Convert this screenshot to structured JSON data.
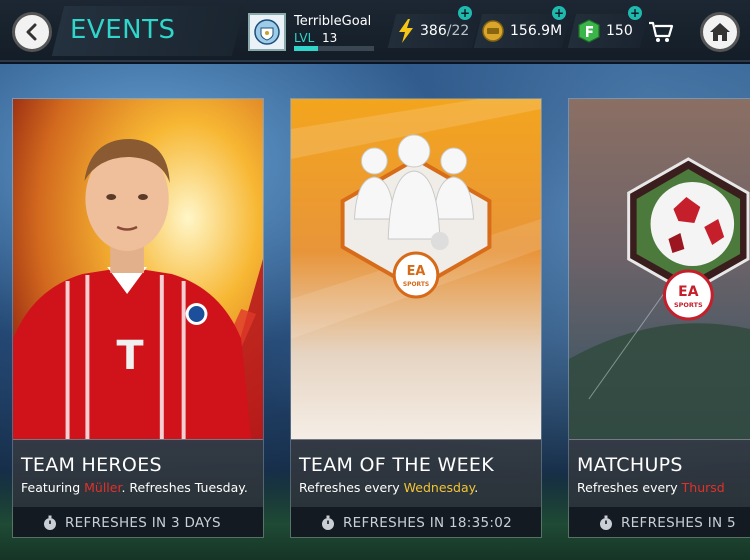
{
  "header": {
    "title": "EVENTS",
    "back_icon": "chevron-left-icon",
    "home_icon": "home-icon"
  },
  "profile": {
    "username": "TerribleGoal",
    "level_label": "LVL",
    "level": "13",
    "xp_progress": 0.3,
    "badge_icon": "club-crest-icon"
  },
  "currencies": {
    "stamina": {
      "value": "386",
      "max": "/22",
      "icon": "lightning-icon",
      "plus": "+"
    },
    "coins": {
      "value": "156.9M",
      "icon": "coin-icon",
      "plus": "+"
    },
    "points": {
      "value": "150",
      "icon": "fifa-points-icon",
      "plus": "+"
    },
    "cart_icon": "cart-icon"
  },
  "cards": [
    {
      "title": "TEAM HEROES",
      "desc_prefix": "Featuring ",
      "desc_highlight": "Müller",
      "desc_suffix": ". Refreshes Tuesday.",
      "footer": "REFRESHES IN 3 DAYS",
      "art": "player-portrait"
    },
    {
      "title": "TEAM OF THE WEEK",
      "desc_prefix": "Refreshes every ",
      "desc_highlight": "Wednesday",
      "desc_suffix": ".",
      "footer": "REFRESHES IN 18:35:02",
      "art": "team-badge"
    },
    {
      "title": "MATCHUPS",
      "desc_prefix": "Refreshes every ",
      "desc_highlight": "Thursd",
      "desc_suffix": "",
      "footer": "REFRESHES IN 5",
      "art": "ball-badge"
    }
  ],
  "brand": {
    "ea_text": "EA",
    "sports_text": "SPORTS"
  },
  "jersey": {
    "letter": "T"
  },
  "colors": {
    "accent": "#2fd6c9",
    "red": "#e2302a",
    "yellow": "#f2c433"
  }
}
